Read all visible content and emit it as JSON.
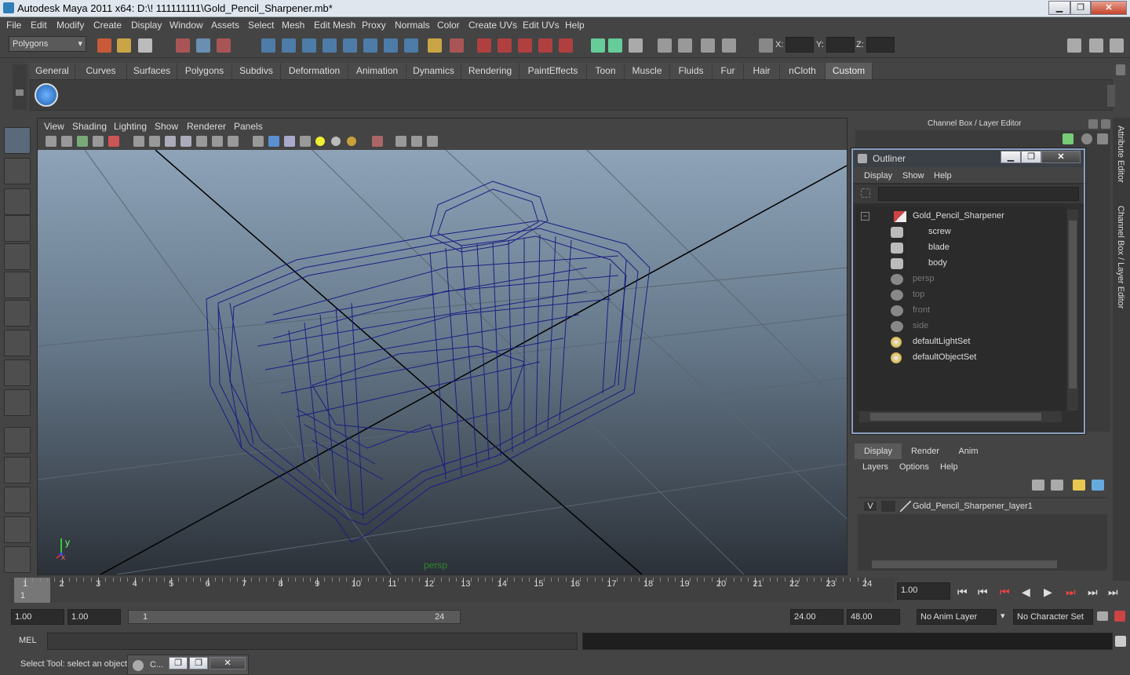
{
  "window": {
    "title": "Autodesk Maya 2011 x64: D:\\! 111111111\\Gold_Pencil_Sharpener.mb*",
    "min": "▁",
    "max": "❐",
    "close": "✕"
  },
  "menu": [
    "File",
    "Edit",
    "Modify",
    "Create",
    "Display",
    "Window",
    "Assets",
    "Select",
    "Mesh",
    "Edit Mesh",
    "Proxy",
    "Normals",
    "Color",
    "Create UVs",
    "Edit UVs",
    "Help"
  ],
  "status": {
    "mode": "Polygons",
    "x_label": "X:",
    "y_label": "Y:",
    "z_label": "Z:"
  },
  "shelf_tabs": [
    "General",
    "Curves",
    "Surfaces",
    "Polygons",
    "Subdivs",
    "Deformation",
    "Animation",
    "Dynamics",
    "Rendering",
    "PaintEffects",
    "Toon",
    "Muscle",
    "Fluids",
    "Fur",
    "Hair",
    "nCloth",
    "Custom"
  ],
  "active_shelf": "Custom",
  "viewport": {
    "menu": [
      "View",
      "Shading",
      "Lighting",
      "Show",
      "Renderer",
      "Panels"
    ],
    "camera_label": "persp",
    "axis_y": "y",
    "axis_x": "x"
  },
  "channel_box": {
    "title": "Channel Box / Layer Editor"
  },
  "outliner": {
    "title": "Outliner",
    "menu": [
      "Display",
      "Show",
      "Help"
    ],
    "items": [
      {
        "label": "Gold_Pencil_Sharpener",
        "type": "group",
        "dim": false
      },
      {
        "label": "screw",
        "type": "mesh",
        "dim": false
      },
      {
        "label": "blade",
        "type": "mesh",
        "dim": false
      },
      {
        "label": "body",
        "type": "mesh",
        "dim": false
      },
      {
        "label": "persp",
        "type": "camera",
        "dim": true
      },
      {
        "label": "top",
        "type": "camera",
        "dim": true
      },
      {
        "label": "front",
        "type": "camera",
        "dim": true
      },
      {
        "label": "side",
        "type": "camera",
        "dim": true
      },
      {
        "label": "defaultLightSet",
        "type": "set",
        "dim": false
      },
      {
        "label": "defaultObjectSet",
        "type": "set",
        "dim": false
      }
    ],
    "collapse": "−"
  },
  "layer_editor": {
    "tabs": [
      "Display",
      "Render",
      "Anim"
    ],
    "menu": [
      "Layers",
      "Options",
      "Help"
    ],
    "layer": {
      "visibility": "V",
      "name": "Gold_Pencil_Sharpener_layer1"
    }
  },
  "side_tabs": [
    "Attribute Editor",
    "Channel Box / Layer Editor"
  ],
  "timeline": {
    "ticks": [
      1,
      2,
      3,
      4,
      5,
      6,
      7,
      8,
      9,
      10,
      11,
      12,
      13,
      14,
      15,
      16,
      17,
      18,
      19,
      20,
      21,
      22,
      23,
      24
    ],
    "current_frame": "1",
    "current_field": "1.00"
  },
  "range": {
    "start": "1.00",
    "start2": "1.00",
    "slider_start": "1",
    "slider_end": "24",
    "end": "24.00",
    "end2": "48.00",
    "anim_layer": "No Anim Layer",
    "char_set": "No Character Set"
  },
  "command": {
    "label": "MEL"
  },
  "help": {
    "text": "Select Tool: select an object",
    "taskbar_item": "C..."
  }
}
